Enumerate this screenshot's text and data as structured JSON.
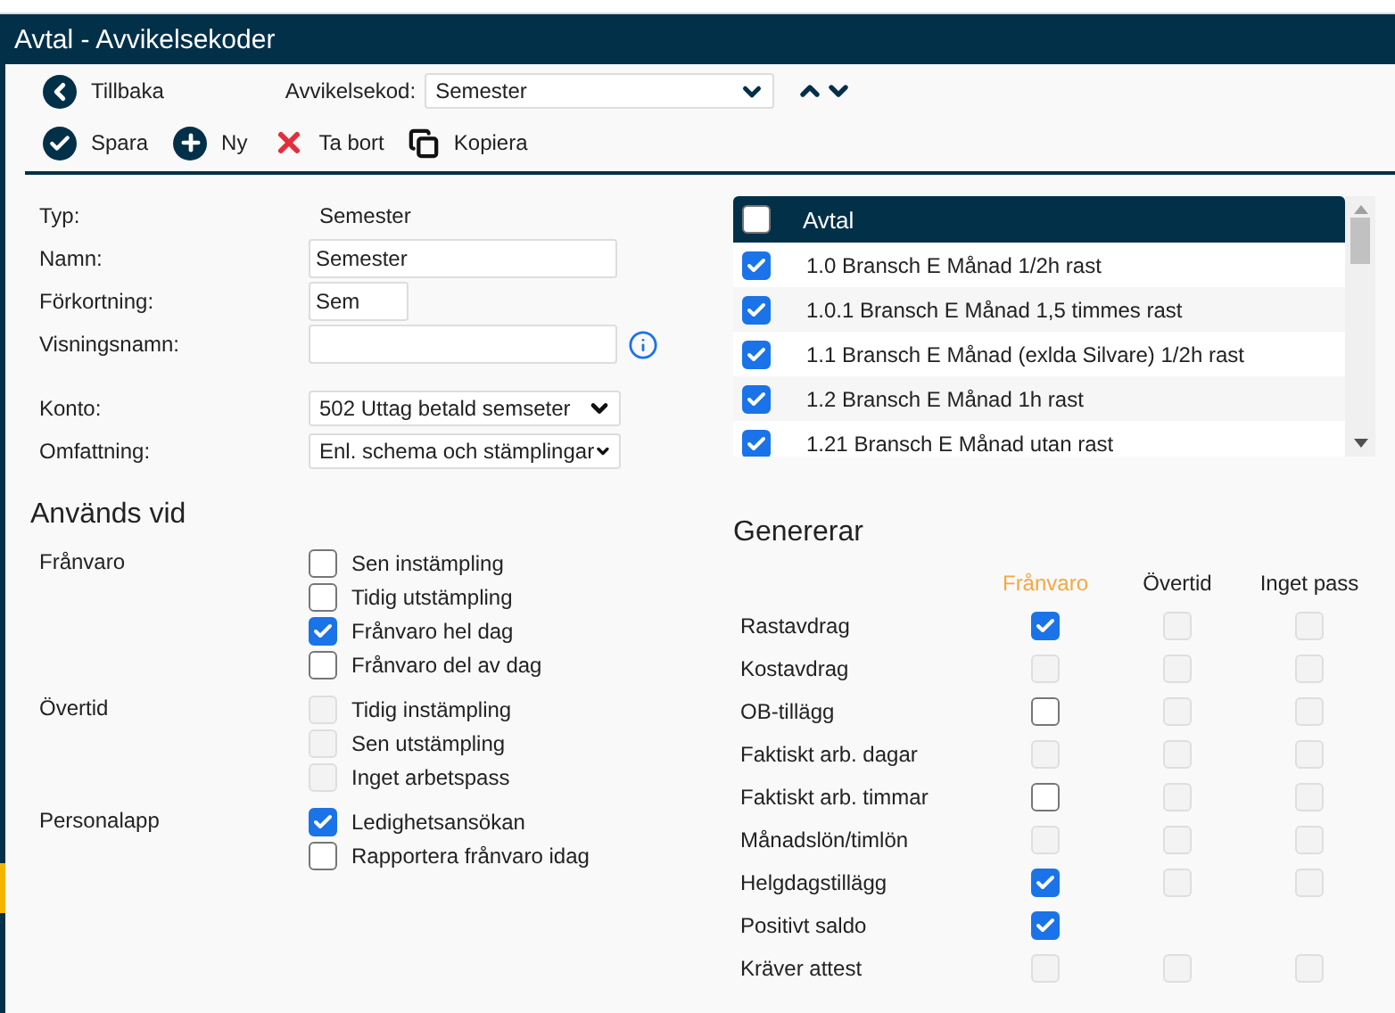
{
  "window": {
    "title": "Avtal - Avvikelsekoder"
  },
  "toolbar": {
    "back": "Tillbaka",
    "code_label": "Avvikelsekod:",
    "code_value": "Semester",
    "actions": [
      {
        "kind": "save",
        "label": "Spara"
      },
      {
        "kind": "new",
        "label": "Ny"
      },
      {
        "kind": "delete",
        "label": "Ta bort"
      },
      {
        "kind": "copy",
        "label": "Kopiera"
      }
    ]
  },
  "form": [
    {
      "kind": "text",
      "label": "Typ:",
      "value": "Semester"
    },
    {
      "kind": "input",
      "label": "Namn:",
      "value": "Semester"
    },
    {
      "kind": "short_input",
      "label": "Förkortning:",
      "value": "Sem"
    },
    {
      "kind": "info_input",
      "label": "Visningsnamn:"
    },
    {
      "kind": "select",
      "label": "Konto:",
      "value": "502 Uttag betald semseter"
    },
    {
      "kind": "select",
      "label": "Omfattning:",
      "value": "Enl. schema och stämplingar"
    }
  ],
  "used_in": {
    "title": "Används vid",
    "groups": [
      {
        "label": "Frånvaro",
        "options": [
          {
            "label": "Sen instämpling",
            "checked": false,
            "disabled": false
          },
          {
            "label": "Tidig utstämpling",
            "checked": false,
            "disabled": false
          },
          {
            "label": "Frånvaro hel dag",
            "checked": true,
            "disabled": false
          },
          {
            "label": "Frånvaro del av dag",
            "checked": false,
            "disabled": false
          }
        ]
      },
      {
        "label": "Övertid",
        "options": [
          {
            "label": "Tidig instämpling",
            "checked": false,
            "disabled": true
          },
          {
            "label": "Sen utstämpling",
            "checked": false,
            "disabled": true
          },
          {
            "label": "Inget arbetspass",
            "checked": false,
            "disabled": true
          }
        ]
      },
      {
        "label": "Personalapp",
        "options": [
          {
            "label": "Ledighetsansökan",
            "checked": true,
            "disabled": false
          },
          {
            "label": "Rapportera frånvaro idag",
            "checked": false,
            "disabled": false
          }
        ]
      }
    ]
  },
  "agreements": {
    "header": "Avtal",
    "all_checked": false,
    "rows": [
      {
        "label": "1.0 Bransch E Månad 1/2h rast",
        "checked": true
      },
      {
        "label": "1.0.1 Bransch E Månad 1,5 timmes rast",
        "checked": true
      },
      {
        "label": "1.1 Bransch E Månad (exlda Silvare) 1/2h rast",
        "checked": true
      },
      {
        "label": "1.2 Bransch E Månad 1h rast",
        "checked": true
      },
      {
        "label": "1.21 Bransch E Månad utan rast",
        "checked": true
      }
    ]
  },
  "generates": {
    "title": "Genererar",
    "columns": [
      {
        "label": "Frånvaro",
        "highlighted": true
      },
      {
        "label": "Övertid",
        "highlighted": false
      },
      {
        "label": "Inget pass",
        "highlighted": false
      }
    ],
    "rows": [
      {
        "label": "Rastavdrag",
        "cells": [
          {
            "kind": "checkbox",
            "checked": true,
            "disabled": false
          },
          {
            "kind": "checkbox",
            "checked": false,
            "disabled": true
          },
          {
            "kind": "checkbox",
            "checked": false,
            "disabled": true
          }
        ]
      },
      {
        "label": "Kostavdrag",
        "cells": [
          {
            "kind": "checkbox",
            "checked": false,
            "disabled": true
          },
          {
            "kind": "checkbox",
            "checked": false,
            "disabled": true
          },
          {
            "kind": "checkbox",
            "checked": false,
            "disabled": true
          }
        ]
      },
      {
        "label": "OB-tillägg",
        "cells": [
          {
            "kind": "checkbox",
            "checked": false,
            "disabled": false
          },
          {
            "kind": "checkbox",
            "checked": false,
            "disabled": true
          },
          {
            "kind": "checkbox",
            "checked": false,
            "disabled": true
          }
        ]
      },
      {
        "label": "Faktiskt arb. dagar",
        "cells": [
          {
            "kind": "checkbox",
            "checked": false,
            "disabled": true
          },
          {
            "kind": "checkbox",
            "checked": false,
            "disabled": true
          },
          {
            "kind": "checkbox",
            "checked": false,
            "disabled": true
          }
        ]
      },
      {
        "label": "Faktiskt arb. timmar",
        "cells": [
          {
            "kind": "checkbox",
            "checked": false,
            "disabled": false
          },
          {
            "kind": "checkbox",
            "checked": false,
            "disabled": true
          },
          {
            "kind": "checkbox",
            "checked": false,
            "disabled": true
          }
        ]
      },
      {
        "label": "Månadslön/timlön",
        "cells": [
          {
            "kind": "checkbox",
            "checked": false,
            "disabled": true
          },
          {
            "kind": "checkbox",
            "checked": false,
            "disabled": true
          },
          {
            "kind": "checkbox",
            "checked": false,
            "disabled": true
          }
        ]
      },
      {
        "label": "Helgdagstillägg",
        "cells": [
          {
            "kind": "checkbox",
            "checked": true,
            "disabled": false
          },
          {
            "kind": "checkbox",
            "checked": false,
            "disabled": true
          },
          {
            "kind": "checkbox",
            "checked": false,
            "disabled": true
          }
        ]
      },
      {
        "label": "Positivt saldo",
        "cells": [
          {
            "kind": "checkbox",
            "checked": true,
            "disabled": false
          },
          {
            "kind": "empty"
          },
          {
            "kind": "empty"
          }
        ]
      },
      {
        "label": "Kräver attest",
        "cells": [
          {
            "kind": "checkbox",
            "checked": false,
            "disabled": true
          },
          {
            "kind": "checkbox",
            "checked": false,
            "disabled": true
          },
          {
            "kind": "checkbox",
            "checked": false,
            "disabled": true
          }
        ]
      }
    ]
  }
}
